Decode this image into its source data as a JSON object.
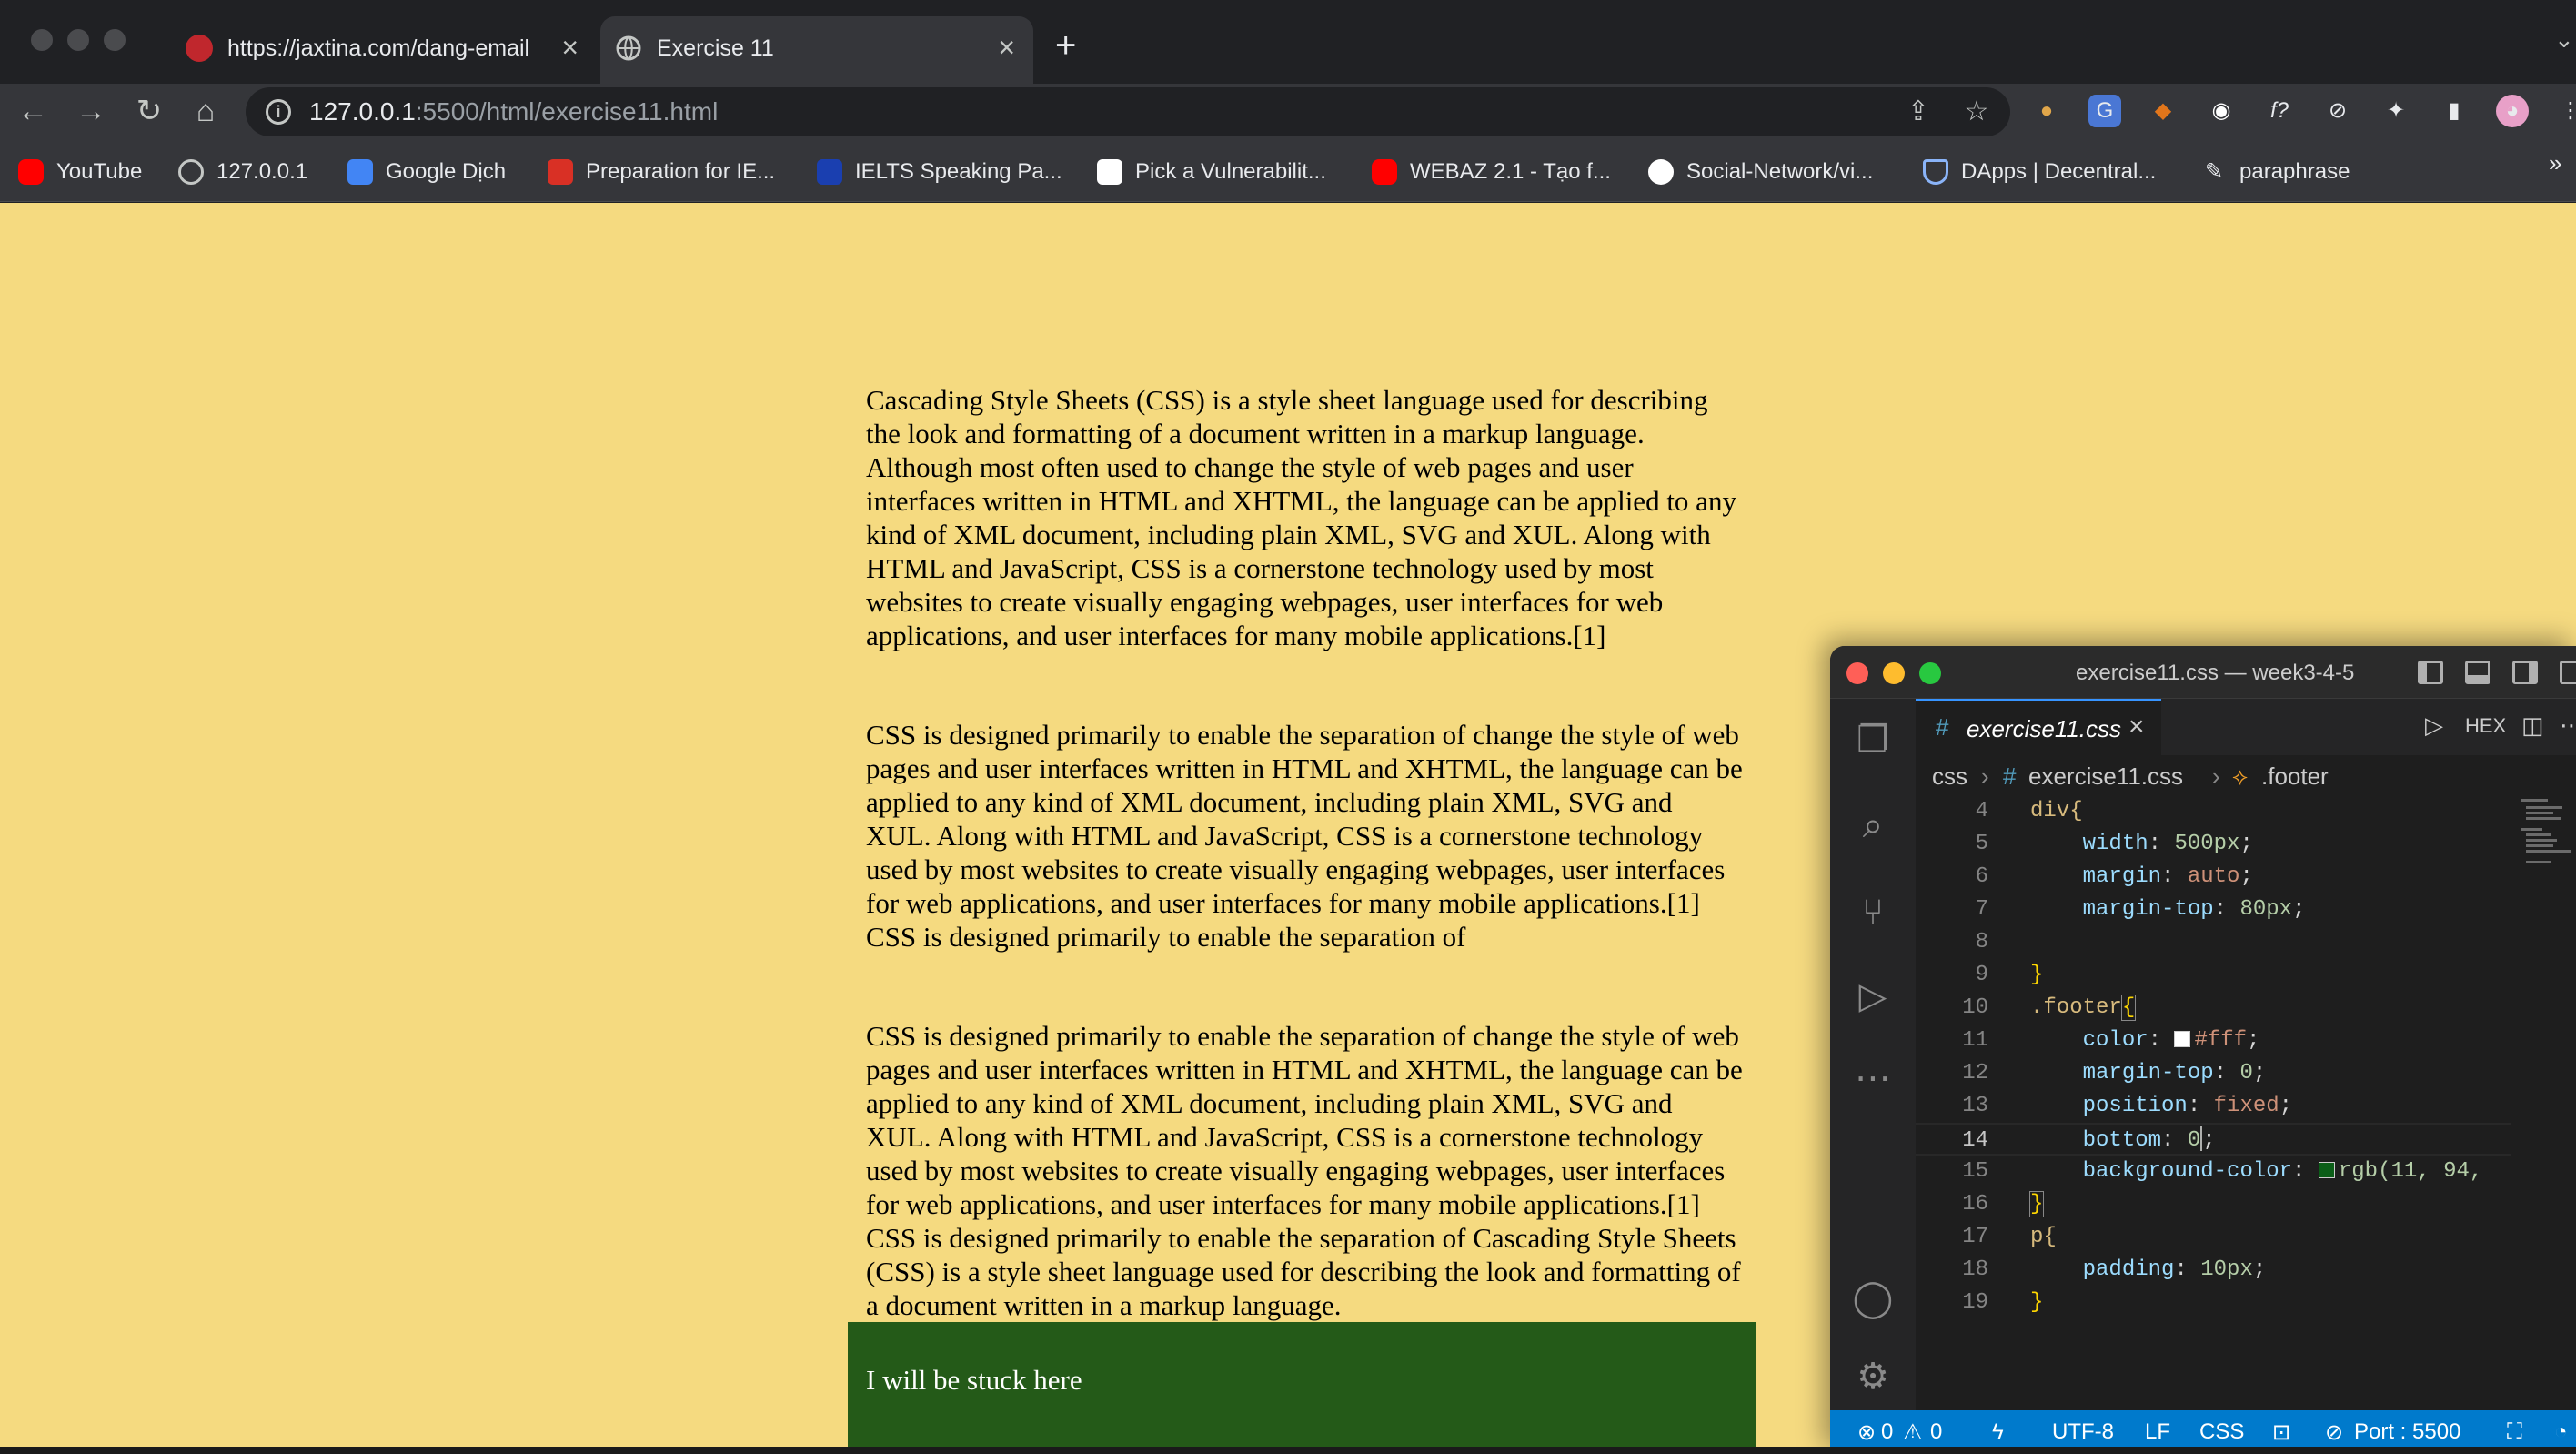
{
  "browser": {
    "tabs": [
      {
        "title": "https://jaxtina.com/dang-email",
        "active": false,
        "favicon": "jaxtina-icon"
      },
      {
        "title": "Exercise 11",
        "active": true,
        "favicon": "globe-icon"
      }
    ],
    "new_tab_label": "+",
    "address": {
      "host": "127.0.0.1",
      "rest": ":5500/html/exercise11.html"
    },
    "bookmarks": [
      {
        "label": "YouTube",
        "icon": "youtube-icon",
        "color": "#ff0000"
      },
      {
        "label": "127.0.0.1",
        "icon": "globe-icon",
        "color": "#c4c7c5"
      },
      {
        "label": "Google Dịch",
        "icon": "google-translate-icon",
        "color": "#4285f4"
      },
      {
        "label": "Preparation for IE...",
        "icon": "preparation-icon",
        "color": "#d93025"
      },
      {
        "label": "IELTS Speaking Pa...",
        "icon": "ielts-icon",
        "color": "#1a3fb0"
      },
      {
        "label": "Pick a Vulnerabilit...",
        "icon": "hackademy-icon",
        "color": "#ffffff"
      },
      {
        "label": "WEBAZ 2.1 - Tạo f...",
        "icon": "youtube-icon",
        "color": "#ff0000"
      },
      {
        "label": "Social-Network/vi...",
        "icon": "github-icon",
        "color": "#ffffff"
      },
      {
        "label": "DApps | Decentral...",
        "icon": "shield-icon",
        "color": "#8ab4f8"
      },
      {
        "label": "paraphrase",
        "icon": "quill-icon",
        "color": "#e8eaed"
      }
    ],
    "more_bookmarks": "»"
  },
  "page": {
    "background": "#f5da80",
    "paragraphs": [
      "Cascading Style Sheets (CSS) is a style sheet language used for describing the look and formatting of a document written in a markup language. Although most often used to change the style of web pages and user interfaces written in HTML and XHTML, the language can be applied to any kind of XML document, including plain XML, SVG and XUL. Along with HTML and JavaScript, CSS is a cornerstone technology used by most websites to create visually engaging webpages, user interfaces for web applications, and user interfaces for many mobile applications.[1]",
      "CSS is designed primarily to enable the separation of change the style of web pages and user interfaces written in HTML and XHTML, the language can be applied to any kind of XML document, including plain XML, SVG and XUL. Along with HTML and JavaScript, CSS is a cornerstone technology used by most websites to create visually engaging webpages, user interfaces for web applications, and user interfaces for many mobile applications.[1] CSS is designed primarily to enable the separation of",
      "CSS is designed primarily to enable the separation of change the style of web pages and user interfaces written in HTML and XHTML, the language can be applied to any kind of XML document, including plain XML, SVG and XUL. Along with HTML and JavaScript, CSS is a cornerstone technology used by most websites to create visually engaging webpages, user interfaces for web applications, and user interfaces for many mobile applications.[1] CSS is designed primarily to enable the separation of Cascading Style Sheets (CSS) is a style sheet language used for describing the look and formatting of a document written in a markup language."
    ],
    "footer": {
      "text": "I will be stuck here",
      "background": "#245a18",
      "color": "#ffffff"
    }
  },
  "vscode": {
    "title": "exercise11.css — week3-4-5",
    "tab": {
      "hash": "#",
      "name": "exercise11.css",
      "close": "×"
    },
    "tab_actions": [
      "HEX"
    ],
    "breadcrumb": {
      "folder": "css",
      "file": "exercise11.css",
      "symbol": ".footer"
    },
    "line_numbers": [
      "4",
      "5",
      "6",
      "7",
      "8",
      "9",
      "10",
      "11",
      "12",
      "13",
      "14",
      "15",
      "16",
      "17",
      "18",
      "19"
    ],
    "active_line": "14",
    "code": {
      "l4": "div{",
      "l5_prop": "width",
      "l5_val": "500px",
      "l6_prop": "margin",
      "l6_val": "auto",
      "l7_prop": "margin-top",
      "l7_val": "80px",
      "l9": "}",
      "l10_sel": ".footer",
      "l10_brace": "{",
      "l11_prop": "color",
      "l11_val": "#fff",
      "l12_prop": "margin-top",
      "l12_val": "0",
      "l13_prop": "position",
      "l13_val": "fixed",
      "l14_prop": "bottom",
      "l14_val": "0",
      "l15_prop": "background-color",
      "l15_val": "rgb(11, 94,",
      "l16": "}",
      "l17": "p{",
      "l18_prop": "padding",
      "l18_val": "10px",
      "l19": "}"
    },
    "status": {
      "errors": "0",
      "warnings": "0",
      "encoding": "UTF-8",
      "eol": "LF",
      "language": "CSS",
      "port": "Port : 5500"
    },
    "accent": "#007acc"
  }
}
